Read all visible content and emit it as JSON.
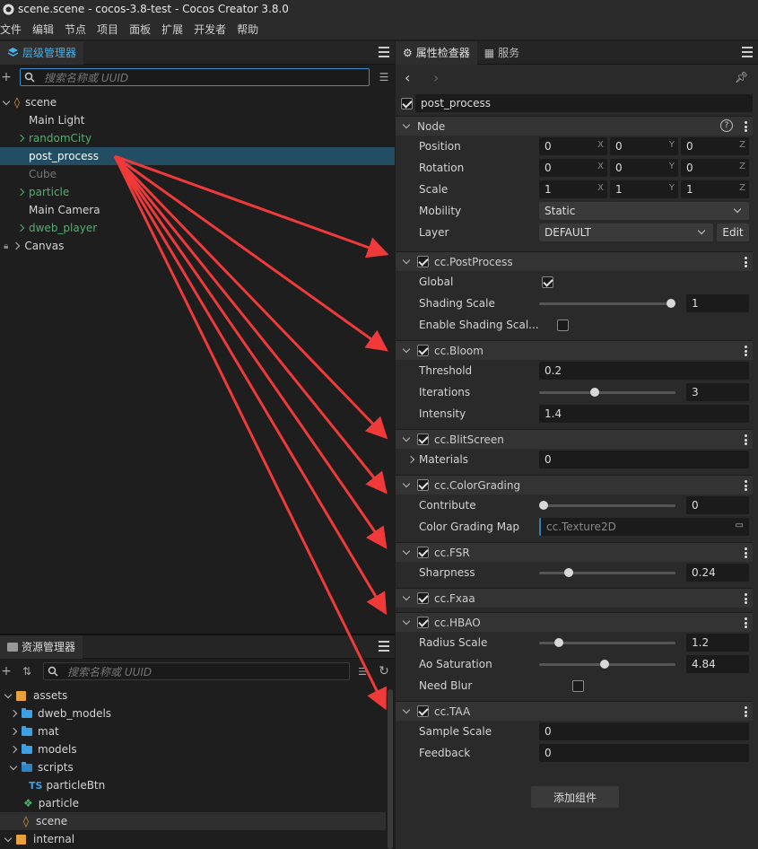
{
  "window": {
    "title": "scene.scene - cocos-3.8-test - Cocos Creator 3.8.0"
  },
  "menu": [
    "文件",
    "编辑",
    "节点",
    "项目",
    "面板",
    "扩展",
    "开发者",
    "帮助"
  ],
  "hierarchy": {
    "tab_label": "层级管理器",
    "search_placeholder": "搜索名称或 UUID",
    "nodes": [
      {
        "label": "scene",
        "style": "normal"
      },
      {
        "label": "Main Light",
        "style": "normal"
      },
      {
        "label": "randomCity",
        "style": "green"
      },
      {
        "label": "post_process",
        "style": "selected"
      },
      {
        "label": "Cube",
        "style": "dim"
      },
      {
        "label": "particle",
        "style": "green"
      },
      {
        "label": "Main Camera",
        "style": "normal"
      },
      {
        "label": "dweb_player",
        "style": "green"
      },
      {
        "label": "Canvas",
        "style": "normal"
      }
    ]
  },
  "assets": {
    "tab_label": "资源管理器",
    "search_placeholder": "搜索名称或 UUID",
    "items": [
      {
        "label": "assets"
      },
      {
        "label": "dweb_models"
      },
      {
        "label": "mat"
      },
      {
        "label": "models"
      },
      {
        "label": "scripts"
      },
      {
        "label": "particleBtn",
        "badge": "TS"
      },
      {
        "label": "particle"
      },
      {
        "label": "scene"
      },
      {
        "label": "internal"
      }
    ]
  },
  "inspector": {
    "tab_label": "属性检查器",
    "service_tab_label": "服务",
    "node_name": "post_process",
    "node_section": {
      "title": "Node",
      "position": {
        "label": "Position",
        "x": "0",
        "y": "0",
        "z": "0"
      },
      "rotation": {
        "label": "Rotation",
        "x": "0",
        "y": "0",
        "z": "0"
      },
      "scale": {
        "label": "Scale",
        "x": "1",
        "y": "1",
        "z": "1"
      },
      "mobility": {
        "label": "Mobility",
        "value": "Static"
      },
      "layer": {
        "label": "Layer",
        "value": "DEFAULT",
        "edit": "Edit"
      },
      "axis": {
        "x": "X",
        "y": "Y",
        "z": "Z"
      }
    },
    "components": {
      "postprocess": {
        "title": "cc.PostProcess",
        "global": "Global",
        "shading_scale": "Shading Scale",
        "shading_scale_value": "1",
        "shading_fraction": 1.0,
        "enable_shading": "Enable Shading Scal..."
      },
      "bloom": {
        "title": "cc.Bloom",
        "threshold": "Threshold",
        "threshold_value": "0.2",
        "iterations": "Iterations",
        "iterations_value": "3",
        "iterations_fraction": 0.4,
        "intensity": "Intensity",
        "intensity_value": "1.4"
      },
      "blit": {
        "title": "cc.BlitScreen",
        "materials": "Materials",
        "materials_value": "0"
      },
      "colorgrading": {
        "title": "cc.ColorGrading",
        "contribute": "Contribute",
        "contribute_value": "0",
        "contribute_fraction": 0.0,
        "map": "Color Grading Map",
        "map_value": "cc.Texture2D"
      },
      "fsr": {
        "title": "cc.FSR",
        "sharpness": "Sharpness",
        "sharpness_value": "0.24",
        "sharpness_fraction": 0.2
      },
      "fxaa": {
        "title": "cc.Fxaa"
      },
      "hbao": {
        "title": "cc.HBAO",
        "radius": "Radius Scale",
        "radius_value": "1.2",
        "radius_fraction": 0.12,
        "ao": "Ao Saturation",
        "ao_value": "4.84",
        "ao_fraction": 0.48,
        "blur": "Need Blur"
      },
      "taa": {
        "title": "cc.TAA",
        "sample": "Sample Scale",
        "sample_value": "0",
        "feedback": "Feedback",
        "feedback_value": "0"
      }
    },
    "add_component": "添加组件"
  },
  "colors": {
    "accent": "#4ab0e8",
    "selection": "#224d62",
    "arrow": "#f03a3a"
  }
}
